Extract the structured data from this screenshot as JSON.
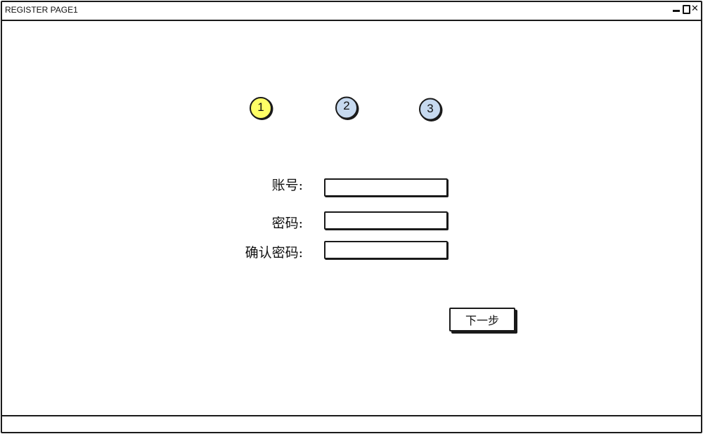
{
  "window": {
    "title": "REGISTER PAGE1",
    "controls": {
      "minimize_icon": "minimize-icon",
      "maximize_icon": "maximize-icon",
      "close_icon": "close-icon",
      "close_glyph": "✕"
    }
  },
  "steps": [
    {
      "number": "1",
      "state": "active",
      "fill": "#ffff66"
    },
    {
      "number": "2",
      "state": "inactive",
      "fill": "#c6d9ef"
    },
    {
      "number": "3",
      "state": "inactive",
      "fill": "#c6d9ef"
    }
  ],
  "form": {
    "account": {
      "label": "账号:",
      "value": "",
      "placeholder": ""
    },
    "password": {
      "label": "密码:",
      "value": "",
      "placeholder": ""
    },
    "confirm_password": {
      "label": "确认密码:",
      "value": "",
      "placeholder": ""
    }
  },
  "actions": {
    "next_label": "下一步"
  },
  "colors": {
    "border": "#1a1a1a",
    "active_step": "#ffff66",
    "inactive_step": "#c6d9ef"
  }
}
